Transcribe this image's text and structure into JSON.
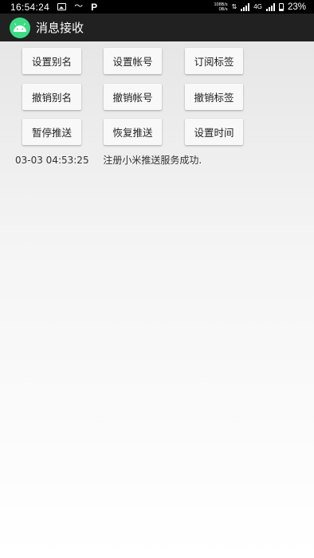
{
  "status_bar": {
    "time": "16:54:24",
    "net_speed_top": "108B/s",
    "net_speed_bottom": "0B/s",
    "network": "4G",
    "battery": "23%",
    "icons": [
      "gallery-icon",
      "wave-icon",
      "p-icon",
      "signal-icon",
      "battery-icon"
    ]
  },
  "app_bar": {
    "title": "消息接收",
    "logo": "android-icon",
    "colors": {
      "background": "#212121",
      "logo": "#3ddc84"
    }
  },
  "buttons": {
    "set_alias": "设置别名",
    "set_account": "设置帐号",
    "subscribe_topic": "订阅标签",
    "unset_alias": "撤销别名",
    "unset_account": "撤销帐号",
    "unsubscribe_topic": "撤销标签",
    "pause_push": "暂停推送",
    "resume_push": "恢复推送",
    "set_time": "设置时间"
  },
  "log": [
    {
      "time": "03-03 04:53:25",
      "message": "注册小米推送服务成功."
    }
  ]
}
